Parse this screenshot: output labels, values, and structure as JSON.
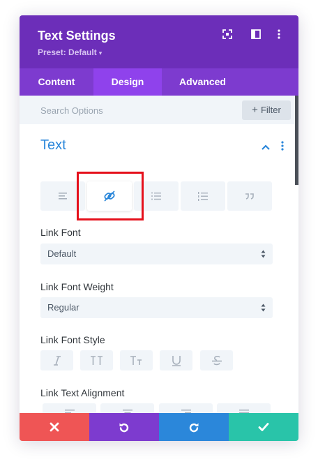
{
  "header": {
    "title": "Text Settings",
    "preset": "Preset: Default",
    "bg_color": "#6c2eb9",
    "icons": [
      "expand-icon",
      "split-view-icon",
      "more-vertical-icon"
    ]
  },
  "tabs": [
    {
      "label": "Content",
      "active": false
    },
    {
      "label": "Design",
      "active": true
    },
    {
      "label": "Advanced",
      "active": false
    }
  ],
  "search": {
    "placeholder": "Search Options",
    "filter_label": "Filter"
  },
  "section": {
    "title": "Text",
    "title_color": "#2b87da",
    "subtabs": [
      {
        "icon": "paragraph-icon",
        "active": false
      },
      {
        "icon": "link-icon",
        "active": true
      },
      {
        "icon": "unordered-list-icon",
        "active": false
      },
      {
        "icon": "ordered-list-icon",
        "active": false
      },
      {
        "icon": "quote-icon",
        "active": false
      }
    ]
  },
  "fields": {
    "link_font": {
      "label": "Link Font",
      "value": "Default"
    },
    "link_font_weight": {
      "label": "Link Font Weight",
      "value": "Regular"
    },
    "link_font_style": {
      "label": "Link Font Style",
      "options": [
        "italic-icon",
        "uppercase-icon",
        "small-caps-icon",
        "underline-icon",
        "strikethrough-icon"
      ]
    },
    "link_text_alignment": {
      "label": "Link Text Alignment",
      "options": [
        "align-left-icon",
        "align-center-icon",
        "align-right-icon",
        "align-justify-icon"
      ]
    }
  },
  "footer": {
    "buttons": [
      {
        "icon": "close-icon",
        "color": "#ef5555"
      },
      {
        "icon": "undo-icon",
        "color": "#7d3bcf"
      },
      {
        "icon": "redo-icon",
        "color": "#2b87da"
      },
      {
        "icon": "check-icon",
        "color": "#29c4a9"
      }
    ]
  },
  "colors": {
    "highlight": "#e5101b",
    "field_bg": "#f1f5f9"
  }
}
